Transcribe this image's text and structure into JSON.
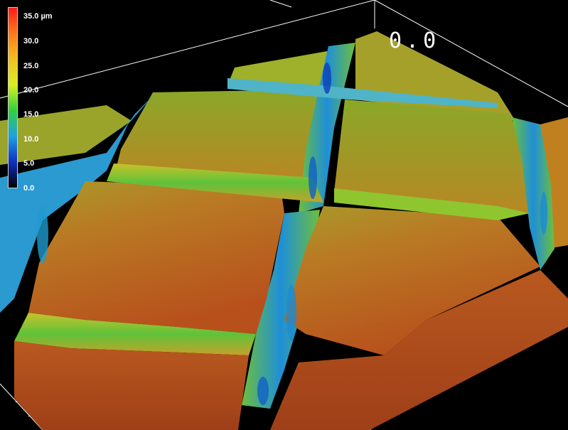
{
  "colorbar": {
    "ticks": [
      "35.0 µm",
      "30.0",
      "25.0",
      "20.0",
      "15.0",
      "10.0",
      "5.0",
      "0.0"
    ],
    "colors": [
      "#ff1a1a",
      "#ff7a1a",
      "#f0c020",
      "#d8f020",
      "#30d040",
      "#20a0e0",
      "#1030c0",
      "#000000"
    ]
  },
  "overlay": {
    "corner_text": "0.0"
  },
  "surface": {
    "top_color": "#c06a22",
    "mid_color": "#c7a52a",
    "groove_color": "#1e8fd8",
    "edge_color": "#3dc24a",
    "deep_color": "#1040c0"
  }
}
